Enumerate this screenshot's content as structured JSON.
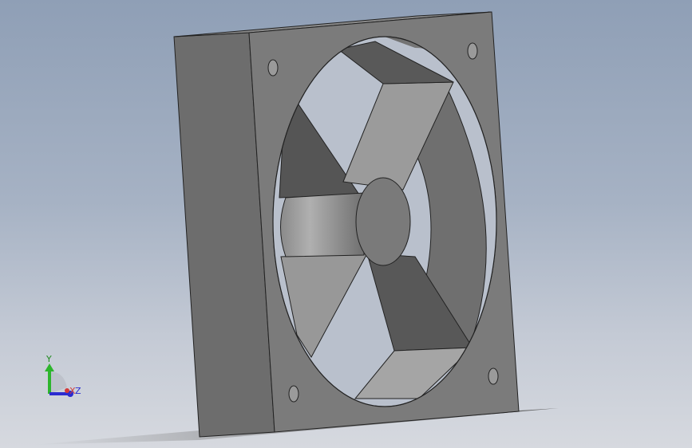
{
  "viewport": {
    "background_top": "#8f9fb6",
    "background_bottom": "#d6d9df"
  },
  "model": {
    "part": "fan-housing",
    "face_color": "#7c7c7c",
    "side_color": "#6c6c6c",
    "blade_dark": "#555555",
    "blade_light": "#9a9a9a",
    "hub_color": "#7a7a7a",
    "mounting_holes": 4,
    "blades": 4
  },
  "triad": {
    "y_label": "Y",
    "x_label": "X",
    "z_label": "Z",
    "y_color": "#2db52d",
    "x_color": "#d23a3a",
    "z_color": "#2b2bd0"
  }
}
